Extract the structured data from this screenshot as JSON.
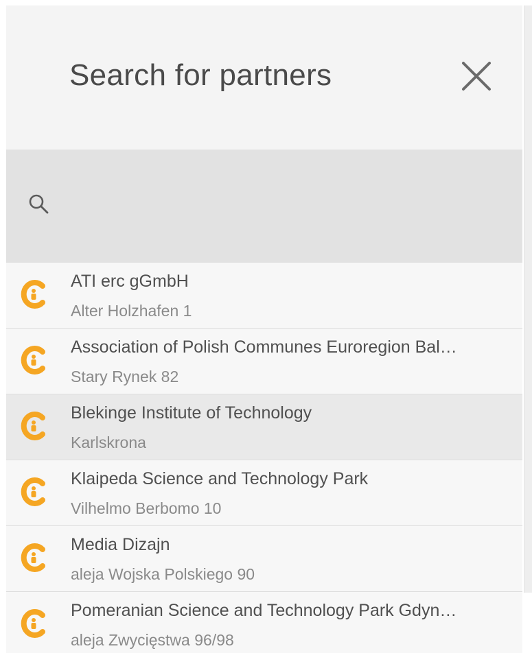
{
  "header": {
    "title": "Search for partners",
    "close_icon": "close-icon"
  },
  "search": {
    "icon": "search-icon",
    "value": "",
    "placeholder": ""
  },
  "colors": {
    "accent": "#f5a623",
    "panel_bg": "#f4f4f4",
    "search_bg": "#e2e2e2",
    "highlight_bg": "#e9e9e9"
  },
  "results": [
    {
      "name": "ATI erc gGmbH",
      "address": "Alter Holzhafen 1",
      "logo_icon": "partner-logo-icon"
    },
    {
      "name": "Association of Polish Communes Euroregion Bal…",
      "address": "Stary Rynek 82",
      "logo_icon": "partner-logo-icon"
    },
    {
      "name": "Blekinge Institute of Technology",
      "address": "Karlskrona",
      "logo_icon": "partner-logo-icon"
    },
    {
      "name": "Klaipeda Science and Technology Park",
      "address": "Vilhelmo Berbomo 10",
      "logo_icon": "partner-logo-icon"
    },
    {
      "name": "Media Dizajn",
      "address": "aleja Wojska Polskiego 90",
      "logo_icon": "partner-logo-icon"
    },
    {
      "name": "Pomeranian Science and Technology Park Gdyn…",
      "address": "aleja Zwycięstwa 96/98",
      "logo_icon": "partner-logo-icon"
    }
  ]
}
